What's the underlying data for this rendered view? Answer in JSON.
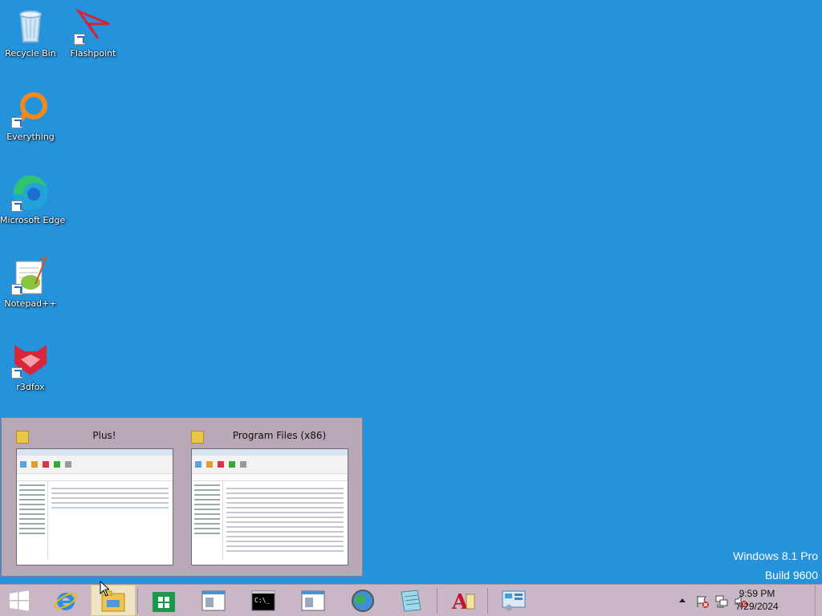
{
  "desktop": {
    "icons": [
      {
        "label": "Recycle Bin",
        "icon": "recycle-bin-icon"
      },
      {
        "label": "Flashpoint",
        "icon": "flashpoint-icon"
      },
      {
        "label": "Everything",
        "icon": "everything-icon"
      },
      {
        "label": "Microsoft Edge",
        "icon": "edge-icon"
      },
      {
        "label": "Notepad++",
        "icon": "notepadpp-icon"
      },
      {
        "label": "r3dfox",
        "icon": "r3dfox-icon"
      }
    ],
    "watermark": {
      "edition": "Windows 8.1 Pro",
      "build": "Build 9600"
    }
  },
  "thumbnails": [
    {
      "title": "Plus!",
      "icon": "folder-icon"
    },
    {
      "title": "Program Files (x86)",
      "icon": "folder-icon"
    }
  ],
  "taskbar": {
    "buttons": [
      {
        "name": "start-button",
        "icon": "windows-logo-icon"
      },
      {
        "name": "internet-explorer",
        "icon": "ie-icon"
      },
      {
        "name": "file-explorer",
        "icon": "file-explorer-icon",
        "active": true
      },
      {
        "name": "store",
        "icon": "store-icon"
      },
      {
        "name": "window-app-1",
        "icon": "window-icon"
      },
      {
        "name": "command-prompt",
        "icon": "cmd-icon"
      },
      {
        "name": "window-app-2",
        "icon": "window-icon"
      },
      {
        "name": "browser-globe",
        "icon": "globe-icon"
      },
      {
        "name": "notepad-app",
        "icon": "notepad-icon"
      },
      {
        "name": "font-app",
        "icon": "font-icon"
      },
      {
        "name": "control-panel",
        "icon": "control-panel-icon"
      }
    ],
    "tray": {
      "icons": [
        "show-hidden-icons-arrow",
        "action-center-flag-icon",
        "network-icon",
        "volume-muted-icon"
      ]
    },
    "clock": {
      "time": "9:59 PM",
      "date": "7/29/2024"
    }
  },
  "colors": {
    "desktop_bg": "#2592dc",
    "taskbar_bg": "#c9b7c6"
  }
}
